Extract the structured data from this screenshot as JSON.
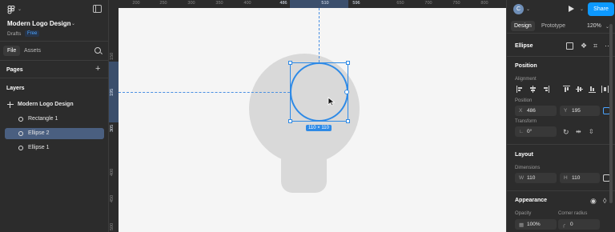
{
  "left_panel": {
    "file_title": "Modern Logo Design",
    "drafts_label": "Drafts",
    "plan_badge": "Free",
    "tabs": [
      "File",
      "Assets"
    ],
    "pages_label": "Pages",
    "layers_label": "Layers",
    "layers": [
      {
        "label": "Modern Logo Design",
        "kind": "frame",
        "selected": false
      },
      {
        "label": "Rectangle 1",
        "kind": "ellipse",
        "selected": false
      },
      {
        "label": "Ellipse 2",
        "kind": "ellipse",
        "selected": true
      },
      {
        "label": "Ellipse 1",
        "kind": "ellipse",
        "selected": false
      }
    ]
  },
  "canvas": {
    "ruler_top": [
      "200",
      "250",
      "300",
      "350",
      "400",
      "486",
      "510",
      "596",
      "650",
      "700",
      "750",
      "800"
    ],
    "ruler_left": [
      "150",
      "195",
      "305",
      "400",
      "450",
      "500"
    ],
    "dimension_badge": "110 × 110"
  },
  "right_panel": {
    "avatar_initial": "C",
    "share_label": "Share",
    "tabs": [
      "Design",
      "Prototype"
    ],
    "zoom": "120%",
    "layer_type": "Ellipse",
    "position": {
      "title": "Position",
      "alignment_label": "Alignment",
      "position_label": "Position",
      "x_key": "X",
      "x": "486",
      "y_key": "Y",
      "y": "195",
      "transform_label": "Transform",
      "rotation": "0°"
    },
    "layout": {
      "title": "Layout",
      "dimensions_label": "Dimensions",
      "w_key": "W",
      "w": "110",
      "h_key": "H",
      "h": "110"
    },
    "appearance": {
      "title": "Appearance",
      "opacity_label": "Opacity",
      "opacity": "100%",
      "corner_label": "Corner radius",
      "corner": "0"
    }
  },
  "colors": {
    "selection": "#2e8ae6",
    "share": "#0d99ff",
    "shape_fill": "#d9d9d9"
  }
}
